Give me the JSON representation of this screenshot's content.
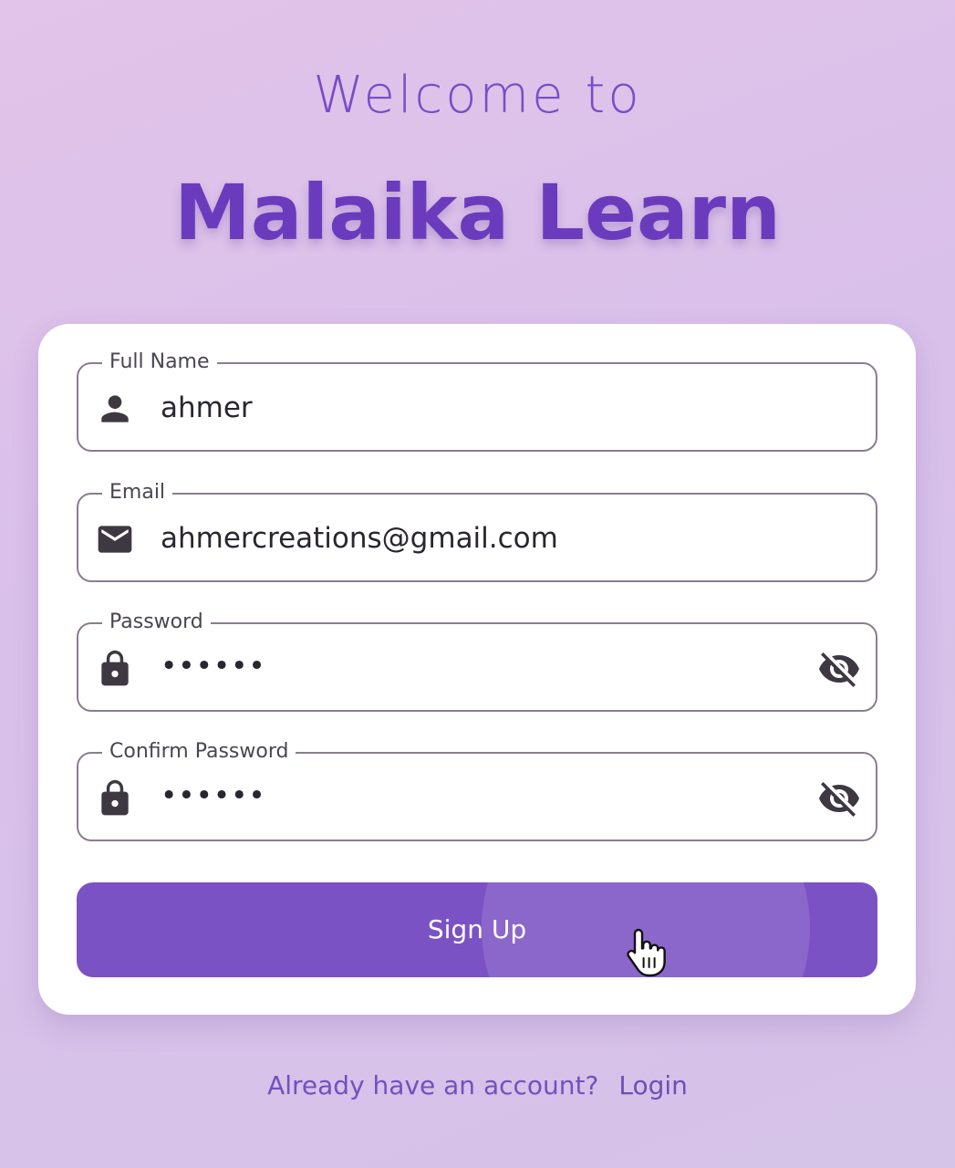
{
  "header": {
    "welcome": "Welcome to",
    "brand": "Malaika Learn"
  },
  "form": {
    "full_name": {
      "label": "Full Name",
      "value": "ahmer",
      "icon": "person-icon"
    },
    "email": {
      "label": "Email",
      "value": "ahmercreations@gmail.com",
      "icon": "mail-icon"
    },
    "password": {
      "label": "Password",
      "value": "••••••",
      "icon": "lock-icon",
      "toggle_icon": "eye-off-icon"
    },
    "confirm_password": {
      "label": "Confirm Password",
      "value": "••••••",
      "icon": "lock-icon",
      "toggle_icon": "eye-off-icon"
    },
    "submit_label": "Sign Up"
  },
  "footer": {
    "prompt": "Already have an account?",
    "login_label": "Login"
  },
  "colors": {
    "accent": "#7b52c4",
    "brand_text": "#6a3cbd",
    "background": "#dcc1ea"
  }
}
